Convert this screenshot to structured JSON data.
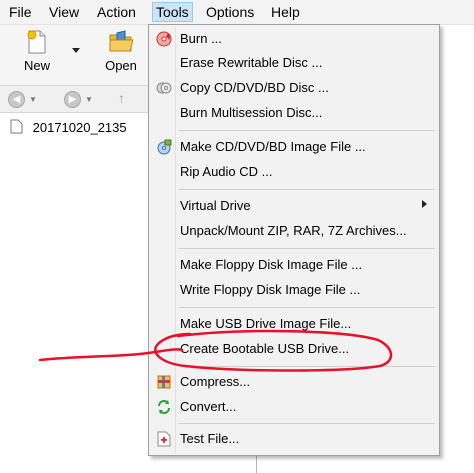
{
  "menubar": {
    "items": [
      {
        "label": "File"
      },
      {
        "label": "View"
      },
      {
        "label": "Action"
      },
      {
        "label": "Tools"
      },
      {
        "label": "Options"
      },
      {
        "label": "Help"
      }
    ]
  },
  "toolbar": {
    "new_label": "New",
    "open_label": "Open"
  },
  "tree": {
    "items": [
      {
        "label": "20171020_2135"
      }
    ]
  },
  "tools_menu": {
    "items": [
      {
        "label": "Burn ..."
      },
      {
        "label": "Erase Rewritable Disc ..."
      },
      {
        "label": "Copy CD/DVD/BD Disc ..."
      },
      {
        "label": "Burn Multisession Disc..."
      },
      {
        "label": "Make CD/DVD/BD Image File ..."
      },
      {
        "label": "Rip Audio CD ..."
      },
      {
        "label": "Virtual Drive"
      },
      {
        "label": "Unpack/Mount ZIP, RAR, 7Z Archives..."
      },
      {
        "label": "Make Floppy Disk Image File ..."
      },
      {
        "label": "Write Floppy Disk Image File ..."
      },
      {
        "label": "Make USB Drive Image File..."
      },
      {
        "label": "Create Bootable USB Drive..."
      },
      {
        "label": "Compress..."
      },
      {
        "label": "Convert..."
      },
      {
        "label": "Test File..."
      }
    ]
  },
  "colors": {
    "annotation": "#e8102a",
    "menu_active_bg": "#cce4f7"
  }
}
